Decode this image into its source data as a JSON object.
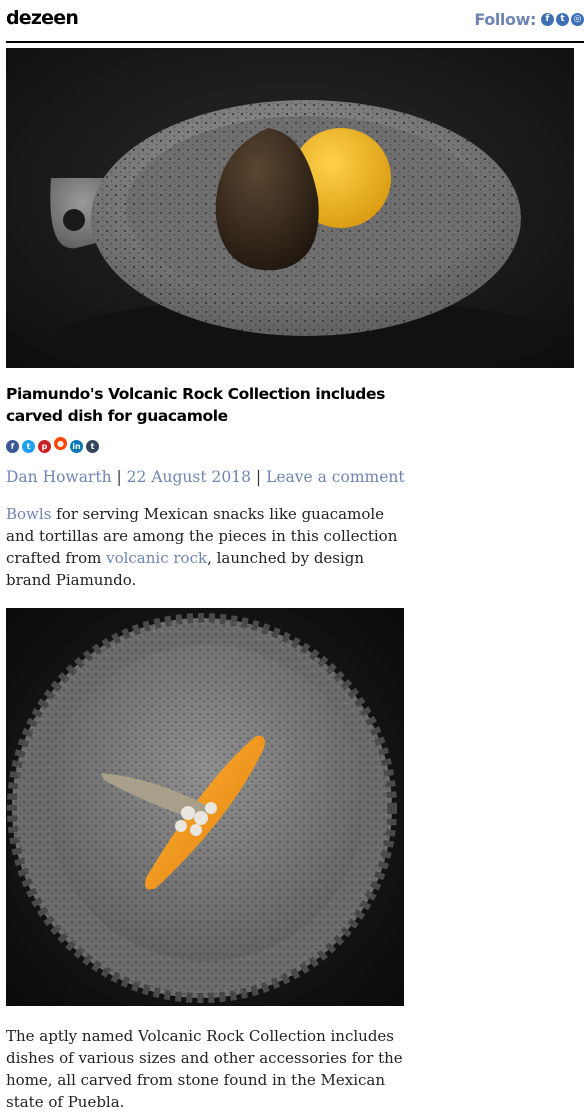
{
  "header": {
    "logo": "dezeen",
    "follow_label": "Follow:",
    "follow_icons": [
      "facebook-icon",
      "twitter-icon",
      "instagram-icon"
    ]
  },
  "article": {
    "title": "Piamundo's Volcanic Rock Collection includes carved dish for guacamole",
    "share_icons": [
      "facebook-icon",
      "twitter-icon",
      "pinterest-icon",
      "reddit-icon",
      "linkedin-icon",
      "tumblr-icon"
    ],
    "author": "Dan Howarth",
    "date": "22 August 2018",
    "comment_link": "Leave a comment",
    "separator": "|",
    "intro": {
      "link1": "Bowls",
      "text1": " for serving Mexican snacks like guacamole and tortillas are among the pieces in this collection crafted from ",
      "link2": "volcanic rock",
      "text2": ", launched by design brand Piamundo."
    },
    "paragraph2": "The aptly named Volcanic Rock Collection includes dishes of various sizes and other accessories for the home, all carved from stone found in the Mexican state of Puebla."
  },
  "colors": {
    "link": "#6f86b3",
    "follow_icon": "#3d6fb5",
    "facebook": "#3b5998",
    "twitter": "#1da1f2",
    "pinterest": "#cb2027",
    "reddit": "#ff4500",
    "linkedin": "#0077b5",
    "tumblr": "#35465c"
  }
}
